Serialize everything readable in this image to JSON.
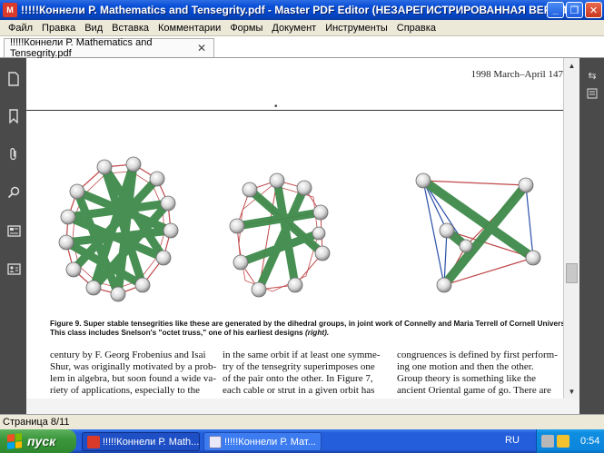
{
  "window": {
    "title": "!!!!!Коннели Р. Mathematics and Tensegrity.pdf - Master PDF Editor (НЕЗАРЕГИСТРИРОВАННАЯ ВЕРСИЯ)",
    "app_icon": "master-pdf-icon",
    "buttons": {
      "minimize": "_",
      "maximize": "❐",
      "close": "✕"
    }
  },
  "menu": [
    "Файл",
    "Правка",
    "Вид",
    "Вставка",
    "Комментарии",
    "Формы",
    "Документ",
    "Инструменты",
    "Справка"
  ],
  "tab": {
    "label": "!!!!!Коннели Р. Mathematics and Tensegrity.pdf",
    "close_icon": "✕"
  },
  "document": {
    "running_head": "1998     March–April     147",
    "center_mark": "•",
    "caption_label": "Figure 9.",
    "caption_text": "Super stable tensegrities like these are generated by the dihedral groups, in joint work of Connelly and Maria Terrell of Cornell University. This class includes Snelson's \"octet truss,\" one of his earliest designs",
    "caption_italic": "(right).",
    "columns": [
      [
        "century by F. Georg Frobenius and Isai",
        "Shur, was originally motivated by a prob-",
        "lem in algebra, but soon found a wide va-",
        "riety of applications, especially to the"
      ],
      [
        "in the same orbit if at least one symme-",
        "try of the tensegrity superimposes one",
        "of the pair onto the other. In Figure 7,",
        "each cable or strut in a given orbit has"
      ],
      [
        "congruences is defined by first perform-",
        "ing one motion and then the other.",
        "    Group theory is something like the",
        "ancient Oriental game of go. There are"
      ]
    ]
  },
  "status": {
    "page": "Страница 8/11"
  },
  "taskbar": {
    "start": "пуск",
    "tasks": [
      "!!!!!Коннели Р. Math...",
      "!!!!!Коннели Р. Мат..."
    ],
    "lang": "RU",
    "clock": "0:54"
  },
  "colors": {
    "strut": "#3f8a4a",
    "cable_red": "#c0484a",
    "cable_blue": "#2a4fa8",
    "node": "#e8e8e8"
  }
}
